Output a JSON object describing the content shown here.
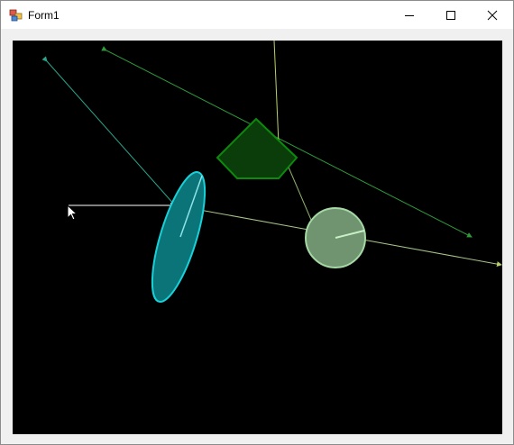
{
  "window": {
    "title": "Form1",
    "app_icon": "form-icon",
    "buttons": {
      "minimize": "minimize-icon",
      "maximize": "maximize-icon",
      "close": "close-icon"
    }
  },
  "canvas": {
    "background": "#000000",
    "colors": {
      "ellipse": "#1ad0d8",
      "ellipse_fill": "#0a7478",
      "pentagon": "#0d8a0d",
      "pentagon_fill": "#0a3d0a",
      "circle": "#a5d8a5",
      "circle_fill": "#6f946f",
      "line_green": "#2e9a3a",
      "line_teal": "#2aa38a",
      "line_yellow": "#b8d06a",
      "line_white": "#ffffff"
    }
  }
}
